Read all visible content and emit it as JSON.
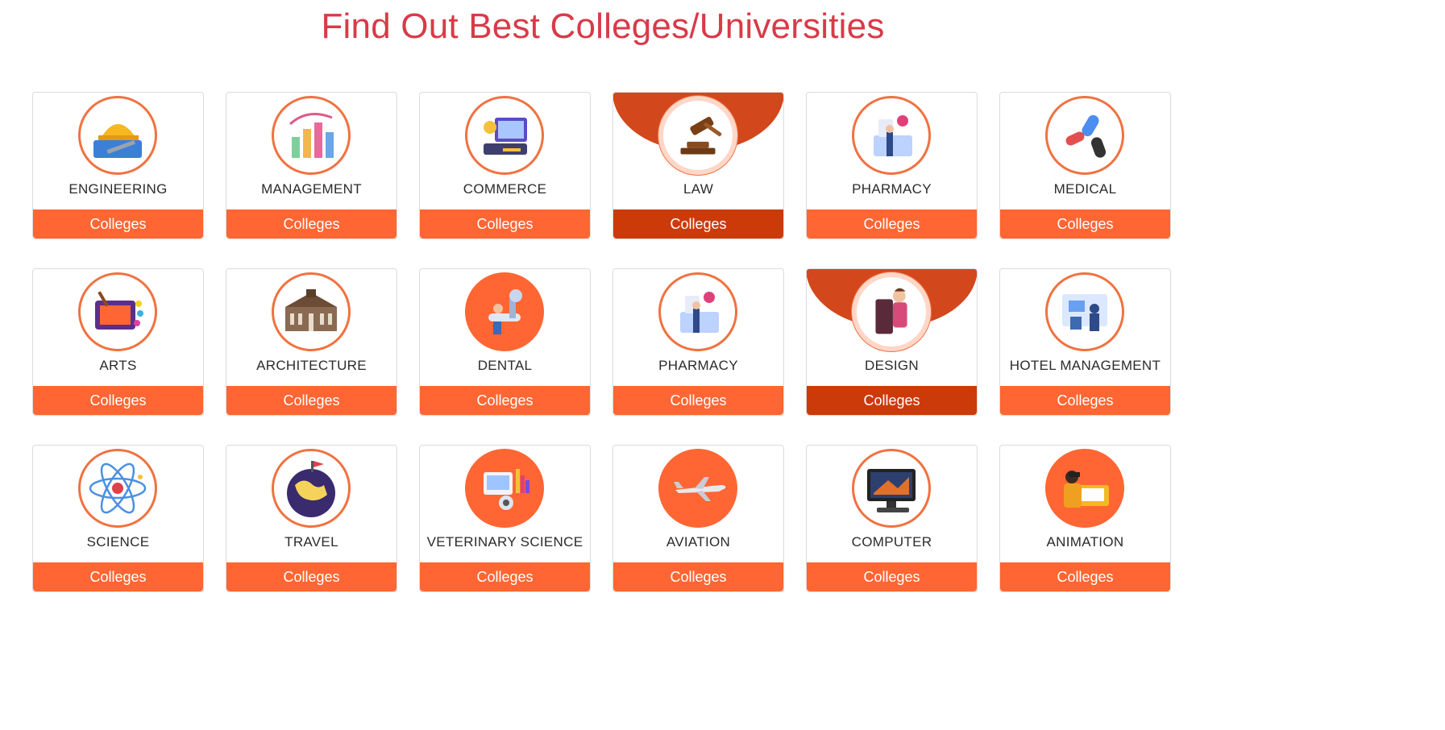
{
  "page_title": "Find Out Best Colleges/Universities",
  "accent_color": "#ff6633",
  "active_color": "#cc3a0a",
  "title_color": "#d93a48",
  "cards": [
    {
      "label": "ENGINEERING",
      "button": "Colleges",
      "icon": "engineering-icon",
      "active": false,
      "filled": false
    },
    {
      "label": "MANAGEMENT",
      "button": "Colleges",
      "icon": "management-icon",
      "active": false,
      "filled": false
    },
    {
      "label": "COMMERCE",
      "button": "Colleges",
      "icon": "commerce-icon",
      "active": false,
      "filled": false
    },
    {
      "label": "LAW",
      "button": "Colleges",
      "icon": "law-icon",
      "active": true,
      "filled": false
    },
    {
      "label": "PHARMACY",
      "button": "Colleges",
      "icon": "pharmacy-icon",
      "active": false,
      "filled": false
    },
    {
      "label": "MEDICAL",
      "button": "Colleges",
      "icon": "medical-icon",
      "active": false,
      "filled": false
    },
    {
      "label": "ARTS",
      "button": "Colleges",
      "icon": "arts-icon",
      "active": false,
      "filled": false
    },
    {
      "label": "ARCHITECTURE",
      "button": "Colleges",
      "icon": "architecture-icon",
      "active": false,
      "filled": false
    },
    {
      "label": "DENTAL",
      "button": "Colleges",
      "icon": "dental-icon",
      "active": false,
      "filled": true
    },
    {
      "label": "PHARMACY",
      "button": "Colleges",
      "icon": "pharmacy-icon",
      "active": false,
      "filled": false
    },
    {
      "label": "DESIGN",
      "button": "Colleges",
      "icon": "design-icon",
      "active": true,
      "filled": false
    },
    {
      "label": "HOTEL MANAGEMENT",
      "button": "Colleges",
      "icon": "hotel-management-icon",
      "active": false,
      "filled": false
    },
    {
      "label": "SCIENCE",
      "button": "Colleges",
      "icon": "science-icon",
      "active": false,
      "filled": false
    },
    {
      "label": "TRAVEL",
      "button": "Colleges",
      "icon": "travel-icon",
      "active": false,
      "filled": false
    },
    {
      "label": "VETERINARY SCIENCE",
      "button": "Colleges",
      "icon": "veterinary-science-icon",
      "active": false,
      "filled": true
    },
    {
      "label": "AVIATION",
      "button": "Colleges",
      "icon": "aviation-icon",
      "active": false,
      "filled": true
    },
    {
      "label": "COMPUTER",
      "button": "Colleges",
      "icon": "computer-icon",
      "active": false,
      "filled": false
    },
    {
      "label": "ANIMATION",
      "button": "Colleges",
      "icon": "animation-icon",
      "active": false,
      "filled": true
    }
  ]
}
